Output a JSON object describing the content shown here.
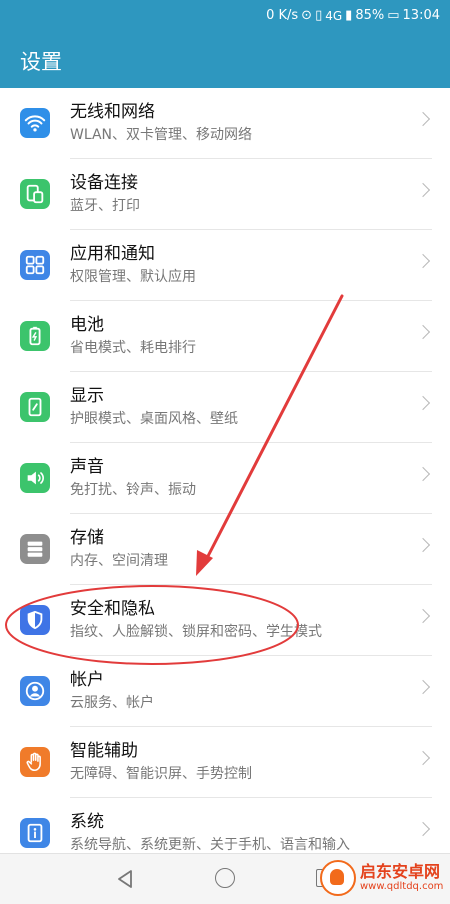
{
  "statusbar": {
    "speed": "0 K/s",
    "signal": "4G",
    "battery": "85%",
    "time": "13:04"
  },
  "header": {
    "title": "设置"
  },
  "items": [
    {
      "title": "无线和网络",
      "subtitle": "WLAN、双卡管理、移动网络",
      "icon": "wifi-icon",
      "color": "#2f8fe8"
    },
    {
      "title": "设备连接",
      "subtitle": "蓝牙、打印",
      "icon": "device-connection-icon",
      "color": "#3cc46c"
    },
    {
      "title": "应用和通知",
      "subtitle": "权限管理、默认应用",
      "icon": "apps-grid-icon",
      "color": "#3f86e6"
    },
    {
      "title": "电池",
      "subtitle": "省电模式、耗电排行",
      "icon": "battery-icon",
      "color": "#3cc46c"
    },
    {
      "title": "显示",
      "subtitle": "护眼模式、桌面风格、壁纸",
      "icon": "display-icon",
      "color": "#3cc46c"
    },
    {
      "title": "声音",
      "subtitle": "免打扰、铃声、振动",
      "icon": "sound-icon",
      "color": "#3cc46c"
    },
    {
      "title": "存储",
      "subtitle": "内存、空间清理",
      "icon": "storage-icon",
      "color": "#8e8e8e"
    },
    {
      "title": "安全和隐私",
      "subtitle": "指纹、人脸解锁、锁屏和密码、学生模式",
      "icon": "shield-icon",
      "color": "#3f74e6"
    },
    {
      "title": "帐户",
      "subtitle": "云服务、帐户",
      "icon": "account-icon",
      "color": "#3f86e6"
    },
    {
      "title": "智能辅助",
      "subtitle": "无障碍、智能识屏、手势控制",
      "icon": "hand-icon",
      "color": "#f07b2a"
    },
    {
      "title": "系统",
      "subtitle": "系统导航、系统更新、关于手机、语言和输入",
      "icon": "info-icon",
      "color": "#3f86e6"
    }
  ],
  "watermark": {
    "name": "启东安卓网",
    "url": "www.qdltdq.com"
  }
}
